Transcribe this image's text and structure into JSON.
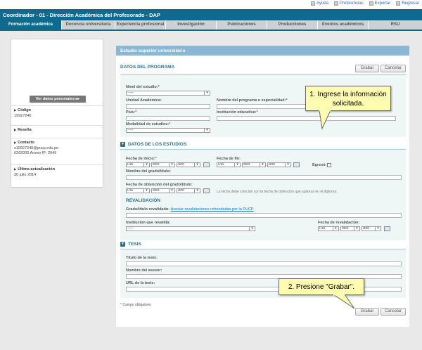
{
  "toplinks": [
    "Ayuda",
    "Preferencias",
    "Exportar",
    "Regresar"
  ],
  "title": "Coordinador - 01 - Dirección Académica del Profesorado - DAP",
  "tabs": [
    "Formación académica",
    "Docencia universitaria",
    "Experiencia profesional",
    "Investigación",
    "Publicaciones",
    "Producciones",
    "Eventos académicos",
    "RSU"
  ],
  "sidebar": {
    "personal_button": "Ver datos personales ▸▸",
    "codigo_label": "Código",
    "codigo_value": "19927240",
    "resena_label": "Reseña",
    "contacto_label": "Contacto",
    "contacto_email": "x19927240@pucp.edu.pe",
    "contacto_phone": "6262000 Anexo IP: 2049",
    "actualizacion_label": "Última actualización",
    "actualizacion_value": "30 julio 2014"
  },
  "main": {
    "heading": "Estudio superior universitario",
    "grabar": "Grabar",
    "cancelar": "Cancelar",
    "datos_programa": "DATOS DEL PROGRAMA",
    "nivel_label": "Nivel del estudio:",
    "nivel_value": "-----",
    "unidad_label": "Unidad Académica:",
    "programa_label": "Nombre del programa o especialidad:",
    "pais_label": "País:",
    "institucion_label": "Institución educativa:",
    "modalidad_label": "Modalidad de estudios:",
    "modalidad_value": "-----",
    "datos_estudios": "DATOS DE LOS ESTUDIOS",
    "fecha_inicio_label": "Fecha de inicio:",
    "fecha_fin_label": "Fecha de fin:",
    "dia": "Día",
    "mes": "Mes",
    "anio": "Año",
    "egreso_label": "Egresó:",
    "grado_label": "Nombre del grado/título:",
    "fecha_obtencion_label": "Fecha de obtención del grado/título:",
    "fecha_note": "La fecha debe coincidir con la fecha de obtención que aparece en el diploma.",
    "revalidacion": "REVALIDACIÓN",
    "grado_revalidado_label": "Grado/título revalidado:",
    "asociar_link": "Asociar revalidaciones refrendadas por la PUCP",
    "institucion_revalida_label": "Institución que revalida:",
    "institucion_revalida_value": "-----",
    "fecha_revalidacion_label": "Fecha de revalidación:",
    "tesis": "TESIS",
    "titulo_tesis_label": "Título de la tesis:",
    "asesor_label": "Nombre del asesor:",
    "url_tesis_label": "URL de la tesis:",
    "campo_obligatorio": "Campo obligatorio"
  },
  "callouts": {
    "one": "1. Ingrese la información solicitada.",
    "two": "2. Presione \"Grabar\"."
  }
}
